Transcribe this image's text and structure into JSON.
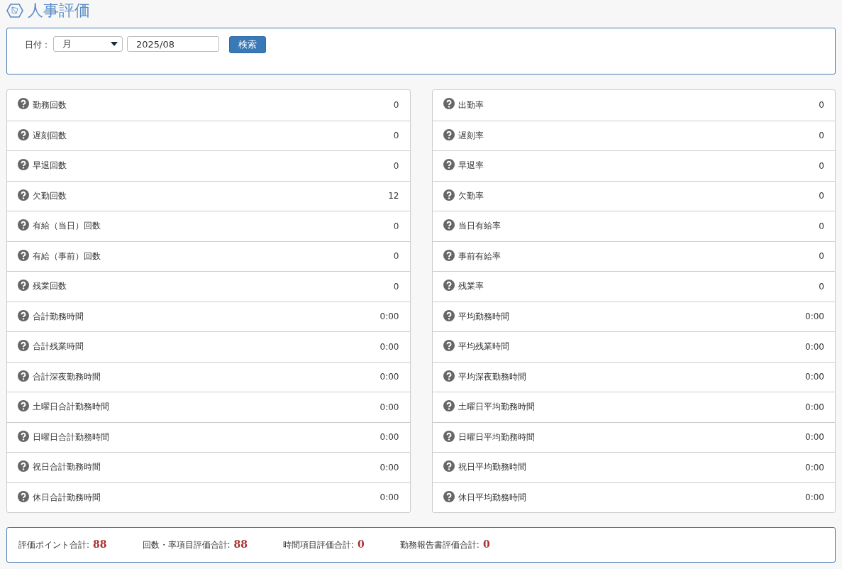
{
  "title": "人事評価",
  "filter": {
    "label": "日付：",
    "period": "月",
    "date": "2025/08",
    "search_button": "検索"
  },
  "left_panel": [
    {
      "label": "勤務回数",
      "value": "0"
    },
    {
      "label": "遅刻回数",
      "value": "0"
    },
    {
      "label": "早退回数",
      "value": "0"
    },
    {
      "label": "欠勤回数",
      "value": "12"
    },
    {
      "label": "有給（当日）回数",
      "value": "0"
    },
    {
      "label": "有給（事前）回数",
      "value": "0"
    },
    {
      "label": "残業回数",
      "value": "0"
    },
    {
      "label": "合計勤務時間",
      "value": "0:00"
    },
    {
      "label": "合計残業時間",
      "value": "0:00"
    },
    {
      "label": "合計深夜勤務時間",
      "value": "0:00"
    },
    {
      "label": "土曜日合計勤務時間",
      "value": "0:00"
    },
    {
      "label": "日曜日合計勤務時間",
      "value": "0:00"
    },
    {
      "label": "祝日合計勤務時間",
      "value": "0:00"
    },
    {
      "label": "休日合計勤務時間",
      "value": "0:00"
    }
  ],
  "right_panel": [
    {
      "label": "出勤率",
      "value": "0"
    },
    {
      "label": "遅刻率",
      "value": "0"
    },
    {
      "label": "早退率",
      "value": "0"
    },
    {
      "label": "欠勤率",
      "value": "0"
    },
    {
      "label": "当日有給率",
      "value": "0"
    },
    {
      "label": "事前有給率",
      "value": "0"
    },
    {
      "label": "残業率",
      "value": "0"
    },
    {
      "label": "平均勤務時間",
      "value": "0:00"
    },
    {
      "label": "平均残業時間",
      "value": "0:00"
    },
    {
      "label": "平均深夜勤務時間",
      "value": "0:00"
    },
    {
      "label": "土曜日平均勤務時間",
      "value": "0:00"
    },
    {
      "label": "日曜日平均勤務時間",
      "value": "0:00"
    },
    {
      "label": "祝日平均勤務時間",
      "value": "0:00"
    },
    {
      "label": "休日平均勤務時間",
      "value": "0:00"
    }
  ],
  "summary": [
    {
      "label": "評価ポイント合計:",
      "value": "88"
    },
    {
      "label": "回数・率項目評価合計:",
      "value": "88"
    },
    {
      "label": "時間項目評価合計:",
      "value": "0"
    },
    {
      "label": "勤務報告書評価合計:",
      "value": "0"
    }
  ]
}
